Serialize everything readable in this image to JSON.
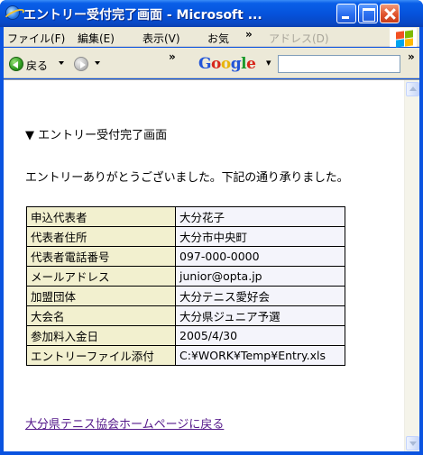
{
  "window": {
    "title": "エントリー受付完了画面 - Microsoft ..."
  },
  "menubar": {
    "items": [
      "ファイル(F)",
      "編集(E)",
      "表示(V)",
      "お気"
    ],
    "overflow": "»",
    "address_label": "アドレス(D)"
  },
  "toolbar": {
    "back_label": "戻る",
    "overflow": "»",
    "google_letters": [
      "G",
      "o",
      "o",
      "g",
      "l",
      "e"
    ],
    "google_dropdown": "▾",
    "search_value": ""
  },
  "page": {
    "heading": "▼ エントリー受付完了画面",
    "intro": "エントリーありがとうございました。下記の通り承りました。",
    "rows": [
      {
        "label": "申込代表者",
        "value": "大分花子"
      },
      {
        "label": "代表者住所",
        "value": "大分市中央町"
      },
      {
        "label": "代表者電話番号",
        "value": "097-000-0000"
      },
      {
        "label": "メールアドレス",
        "value": "junior@opta.jp"
      },
      {
        "label": "加盟団体",
        "value": "大分テニス愛好会"
      },
      {
        "label": "大会名",
        "value": "大分県ジュニア予選"
      },
      {
        "label": "参加料入金日",
        "value": "2005/4/30"
      },
      {
        "label": "エントリーファイル添付",
        "value": "C:¥WORK¥Temp¥Entry.xls"
      }
    ],
    "home_link": "大分県テニス協会ホームページに戻る"
  },
  "colors": {
    "titlebar": "#0553dc",
    "chrome": "#ece9d8",
    "label_cell": "#f2f0cf",
    "value_cell": "#f4f4fb",
    "visited_link": "#551a8b"
  },
  "icons": [
    "ie-logo-icon",
    "minimize-icon",
    "maximize-icon",
    "close-icon",
    "windows-flag-icon",
    "back-arrow-icon",
    "forward-arrow-icon"
  ]
}
